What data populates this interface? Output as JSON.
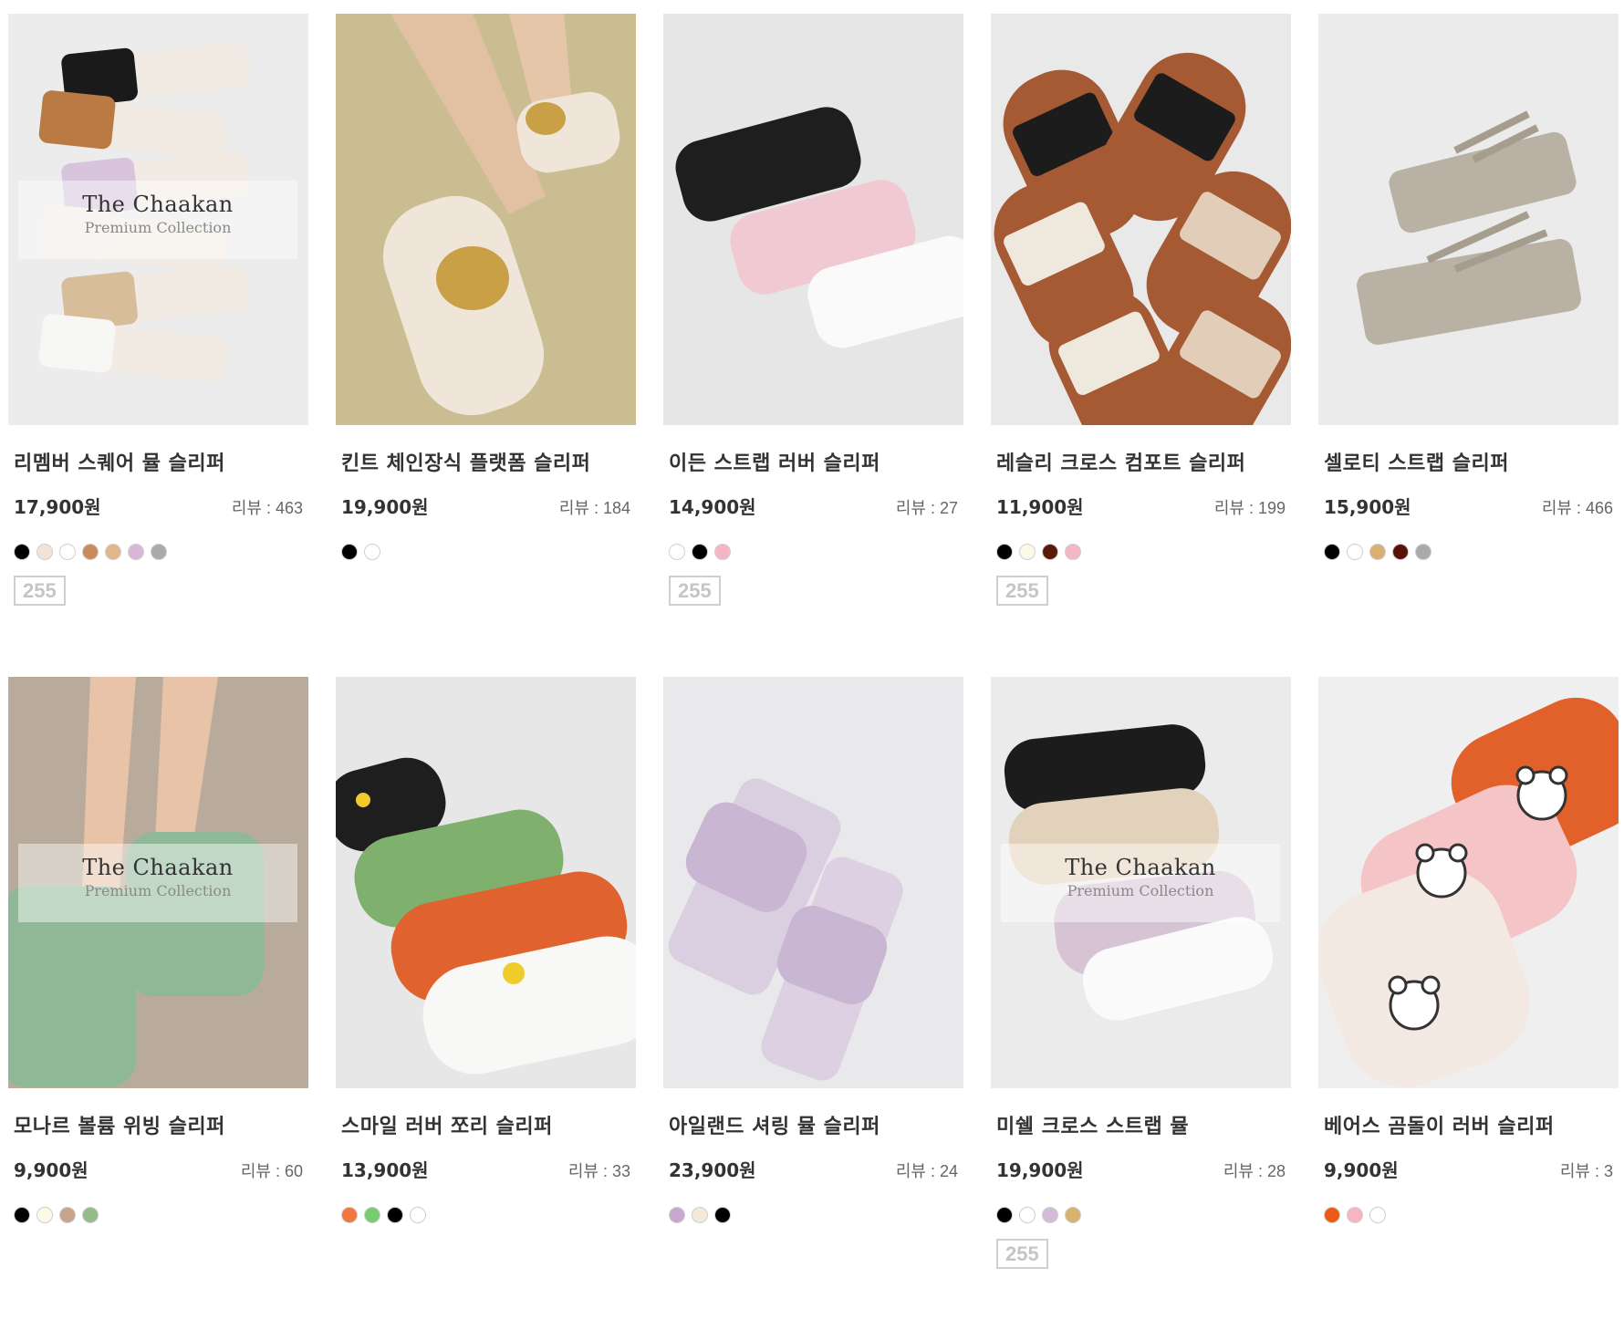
{
  "watermark": {
    "title": "The Chaakan",
    "subtitle": "Premium Collection"
  },
  "review_label": "리뷰 : ",
  "products": [
    {
      "name": "리멤버 스퀘어 뮬 슬리퍼",
      "price": "17,900원",
      "reviews": "463",
      "watermark": true,
      "badge": "255",
      "bg": "#ececec",
      "art": "stack",
      "art_colors": [
        "#1a1a1a",
        "#b97a44",
        "#d8c4dc",
        "#f1ece7",
        "#d8bd9a",
        "#f7f7f5"
      ],
      "swatches": [
        "#000000",
        "#f2e3d8",
        "#ffffff",
        "#c98a5c",
        "#e0b88c",
        "#d6b8d6",
        "#aaaaaa"
      ]
    },
    {
      "name": "킨트 체인장식 플랫폼 슬리퍼",
      "price": "19,900원",
      "reviews": "184",
      "watermark": false,
      "badge": "",
      "bg": "#cdbf95",
      "art": "chain",
      "art_colors": [
        "#efe5d8",
        "#c9a046",
        "#e8c4a6"
      ],
      "swatches": [
        "#000000",
        "#ffffff"
      ]
    },
    {
      "name": "이든 스트랩 러버 슬리퍼",
      "price": "14,900원",
      "reviews": "27",
      "watermark": false,
      "badge": "255",
      "bg": "#e6e6e6",
      "art": "buckle",
      "art_colors": [
        "#1e1e1e",
        "#f1c9d2",
        "#fafafa"
      ],
      "swatches": [
        "#ffffff",
        "#000000",
        "#f5b5c5"
      ]
    },
    {
      "name": "레슬리 크로스 컴포트 슬리퍼",
      "price": "11,900원",
      "reviews": "199",
      "watermark": false,
      "badge": "255",
      "bg": "#e9e9e9",
      "art": "cross",
      "art_colors": [
        "#a55a34",
        "#1c1c1c",
        "#e2cdb9",
        "#efe8dc"
      ],
      "swatches": [
        "#000000",
        "#fbf9e8",
        "#5a1a08",
        "#f5b7c6"
      ]
    },
    {
      "name": "셀로티 스트랩 슬리퍼",
      "price": "15,900원",
      "reviews": "466",
      "watermark": false,
      "badge": "",
      "bg": "#ebebeb",
      "art": "strap",
      "art_colors": [
        "#b9b1a3",
        "#a69d8e"
      ],
      "swatches": [
        "#000000",
        "#ffffff",
        "#dab072",
        "#5a1208",
        "#aaaaaa"
      ]
    },
    {
      "name": "모나르 볼륨 위빙 슬리퍼",
      "price": "9,900원",
      "reviews": "60",
      "watermark": true,
      "badge": "",
      "bg": "#b7aa9c",
      "art": "woven",
      "art_colors": [
        "#8fb897",
        "#e8c3a8",
        "#a18a78"
      ],
      "swatches": [
        "#000000",
        "#fcf9e6",
        "#c8a48a",
        "#94bb88"
      ]
    },
    {
      "name": "스마일 러버 쪼리 슬리퍼",
      "price": "13,900원",
      "reviews": "33",
      "watermark": false,
      "badge": "",
      "bg": "#e7e7e7",
      "art": "flipflop",
      "art_colors": [
        "#1e1e1e",
        "#7fb06e",
        "#e0622e",
        "#f8f8f6",
        "#f0cb2c"
      ],
      "swatches": [
        "#f07840",
        "#78cc70",
        "#000000",
        "#ffffff"
      ]
    },
    {
      "name": "아일랜드 셔링 뮬 슬리퍼",
      "price": "23,900원",
      "reviews": "24",
      "watermark": false,
      "badge": "",
      "bg": "#e9e8ea",
      "art": "heel",
      "art_colors": [
        "#c9b6d2",
        "#ddd0e2"
      ],
      "swatches": [
        "#c8a8d0",
        "#f4e8d8",
        "#000000"
      ]
    },
    {
      "name": "미쉘 크로스 스트랩 뮬",
      "price": "19,900원",
      "reviews": "28",
      "watermark": true,
      "badge": "255",
      "bg": "#ebebeb",
      "art": "mule",
      "art_colors": [
        "#1c1c1c",
        "#e3d2bb",
        "#d6c3d4",
        "#fafafa"
      ],
      "swatches": [
        "#000000",
        "#ffffff",
        "#d2bcd8",
        "#dab270"
      ]
    },
    {
      "name": "베어스 곰돌이 러버 슬리퍼",
      "price": "9,900원",
      "reviews": "3",
      "watermark": false,
      "badge": "",
      "bg": "#efefef",
      "art": "bear",
      "art_colors": [
        "#e2602a",
        "#f5c4c6",
        "#f4e8e2",
        "#ffffff"
      ],
      "swatches": [
        "#ee5a18",
        "#f7b5c0",
        "#ffffff"
      ]
    }
  ]
}
